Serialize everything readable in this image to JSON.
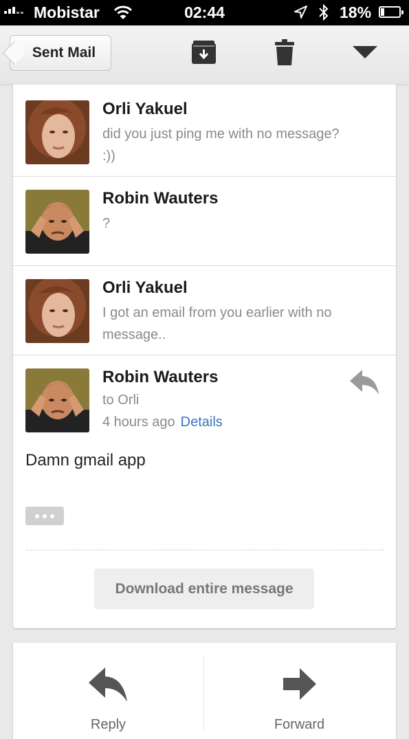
{
  "status_bar": {
    "carrier": "Mobistar",
    "time": "02:44",
    "battery_percent": "18%",
    "battery_level": 0.18
  },
  "toolbar": {
    "back_label": "Sent Mail",
    "icons": [
      "archive-icon",
      "trash-icon",
      "chevron-down-icon"
    ]
  },
  "thread": {
    "messages": [
      {
        "sender": "Orli Yakuel",
        "snippet": "did you just ping me with no message? :))"
      },
      {
        "sender": "Robin Wauters",
        "snippet": "?"
      },
      {
        "sender": "Orli Yakuel",
        "snippet": "I got an email from you earlier with no message.."
      }
    ],
    "open_message": {
      "sender": "Robin Wauters",
      "to": "to Orli",
      "time": "4 hours ago",
      "details_label": "Details",
      "body": "Damn gmail app"
    },
    "download_label": "Download entire message"
  },
  "actions": {
    "reply_label": "Reply",
    "forward_label": "Forward"
  },
  "colors": {
    "link": "#3b73c2",
    "muted_text": "#8a8a8a",
    "background": "#e9e9e9"
  }
}
